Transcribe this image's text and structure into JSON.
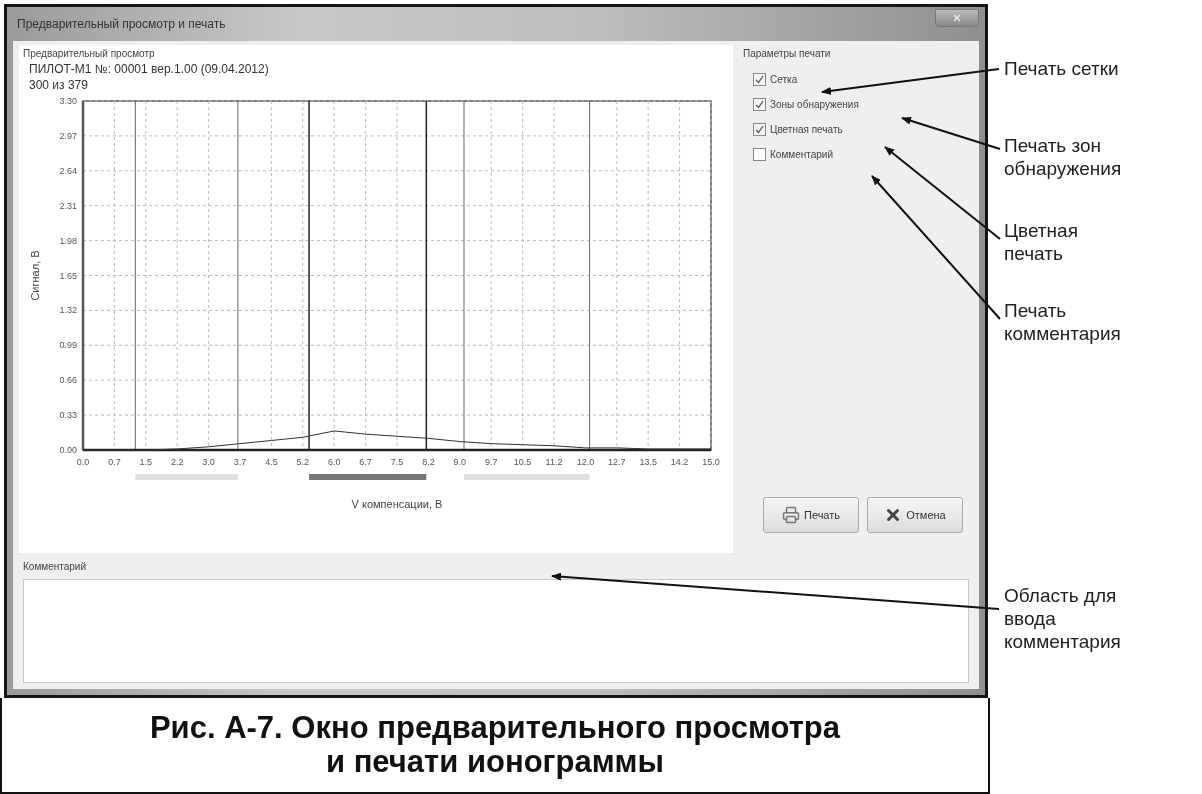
{
  "window": {
    "title": "Предварительный просмотр и печать"
  },
  "preview": {
    "label": "Предварительный просмотр",
    "header": "ПИЛОТ-М1 №: 00001 вер.1.00 (09.04.2012)",
    "counter": "300 из 379",
    "chart_data": {
      "type": "line",
      "xlabel": "V компенсации, В",
      "ylabel": "Сигнал, В",
      "x": [
        0,
        0.75,
        1.5,
        2.25,
        3,
        3.75,
        4.5,
        5.25,
        6,
        6.75,
        7.5,
        8.25,
        9,
        9.75,
        10.5,
        11.25,
        12,
        12.75,
        13.5,
        14.25,
        15
      ],
      "grid": true,
      "series": [
        {
          "color": "#333333",
          "values": [
            0,
            0,
            0,
            0.01,
            0.03,
            0.06,
            0.09,
            0.12,
            0.18,
            0.15,
            0.13,
            0.11,
            0.08,
            0.06,
            0.05,
            0.04,
            0.02,
            0.02,
            0.01,
            0.01,
            0.01
          ]
        }
      ],
      "xlim": [
        0,
        15
      ],
      "ylim": [
        0,
        3.3
      ],
      "xticks": [
        {
          "value": 0,
          "label": "0.0"
        },
        {
          "value": 0.75,
          "label": "0.7"
        },
        {
          "value": 1.5,
          "label": "1.5"
        },
        {
          "value": 2.25,
          "label": "2.2"
        },
        {
          "value": 3,
          "label": "3.0"
        },
        {
          "value": 3.75,
          "label": "3.7"
        },
        {
          "value": 4.5,
          "label": "4.5"
        },
        {
          "value": 5.25,
          "label": "5.2"
        },
        {
          "value": 6,
          "label": "6.0"
        },
        {
          "value": 6.75,
          "label": "6.7"
        },
        {
          "value": 7.5,
          "label": "7.5"
        },
        {
          "value": 8.25,
          "label": "8.2"
        },
        {
          "value": 9,
          "label": "9.0"
        },
        {
          "value": 9.75,
          "label": "9.7"
        },
        {
          "value": 10.5,
          "label": "10.5"
        },
        {
          "value": 11.25,
          "label": "11.2"
        },
        {
          "value": 12,
          "label": "12.0"
        },
        {
          "value": 12.75,
          "label": "12.7"
        },
        {
          "value": 13.5,
          "label": "13.5"
        },
        {
          "value": 14.25,
          "label": "14.2"
        },
        {
          "value": 15,
          "label": "15.0"
        }
      ],
      "yticks": [
        {
          "value": 0,
          "label": "0.00"
        },
        {
          "value": 0.33,
          "label": "0.33"
        },
        {
          "value": 0.66,
          "label": "0.66"
        },
        {
          "value": 0.99,
          "label": "0.99"
        },
        {
          "value": 1.32,
          "label": "1.32"
        },
        {
          "value": 1.65,
          "label": "1.65"
        },
        {
          "value": 1.98,
          "label": "1.98"
        },
        {
          "value": 2.31,
          "label": "2.31"
        },
        {
          "value": 2.64,
          "label": "2.64"
        },
        {
          "value": 2.97,
          "label": "2.97"
        },
        {
          "value": 3.3,
          "label": "3.30"
        }
      ],
      "ref_lines": [
        {
          "axis": "x",
          "value": 1.25
        },
        {
          "axis": "x",
          "value": 3.7
        },
        {
          "axis": "x",
          "value": 5.4
        },
        {
          "axis": "x",
          "value": 8.2
        },
        {
          "axis": "x",
          "value": 9.1
        },
        {
          "axis": "x",
          "value": 12.1
        }
      ]
    },
    "zones": [
      {
        "selected": false
      },
      {
        "selected": true
      },
      {
        "selected": false
      }
    ]
  },
  "print_options": {
    "label": "Параметры печати",
    "items": [
      {
        "label": "Сетка",
        "checked": true
      },
      {
        "label": "Зоны обнаружения",
        "checked": true
      },
      {
        "label": "Цветная печать",
        "checked": true
      },
      {
        "label": "Комментарий",
        "checked": false
      }
    ]
  },
  "buttons": [
    {
      "kind": "print",
      "label": "Печать"
    },
    {
      "kind": "cancel",
      "label": "Отмена"
    }
  ],
  "comment": {
    "label": "Комментарий"
  },
  "callouts": [
    {
      "text": "Печать сетки"
    },
    {
      "text": "Печать зон обнаружения"
    },
    {
      "text": "Цветная печать"
    },
    {
      "text": "Печать комментария"
    },
    {
      "text": "Область для ввода комментария"
    }
  ],
  "caption": "Рис. А-7. Окно предварительного просмотра и печати ионограммы"
}
